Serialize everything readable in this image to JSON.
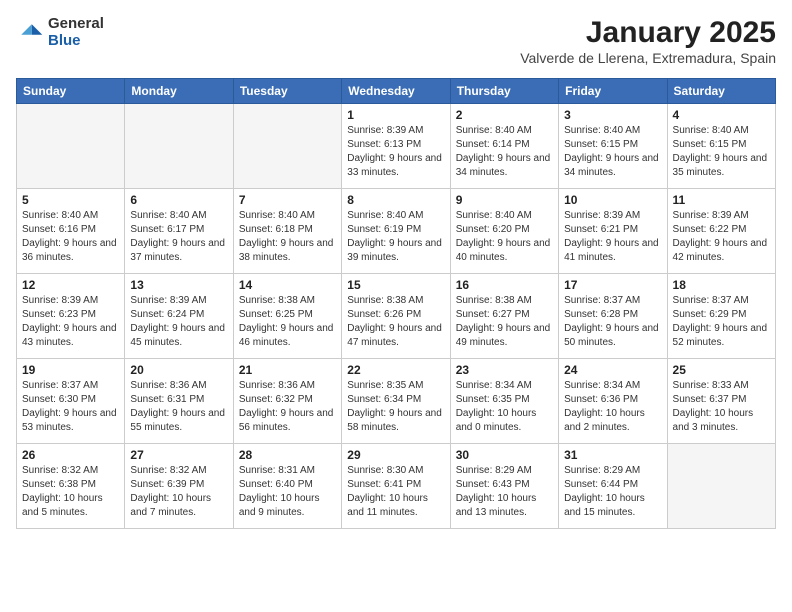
{
  "header": {
    "logo_general": "General",
    "logo_blue": "Blue",
    "month": "January 2025",
    "location": "Valverde de Llerena, Extremadura, Spain"
  },
  "days_of_week": [
    "Sunday",
    "Monday",
    "Tuesday",
    "Wednesday",
    "Thursday",
    "Friday",
    "Saturday"
  ],
  "weeks": [
    [
      {
        "day": "",
        "empty": true
      },
      {
        "day": "",
        "empty": true
      },
      {
        "day": "",
        "empty": true
      },
      {
        "day": "1",
        "sunrise": "8:39 AM",
        "sunset": "6:13 PM",
        "daylight": "9 hours and 33 minutes."
      },
      {
        "day": "2",
        "sunrise": "8:40 AM",
        "sunset": "6:14 PM",
        "daylight": "9 hours and 34 minutes."
      },
      {
        "day": "3",
        "sunrise": "8:40 AM",
        "sunset": "6:15 PM",
        "daylight": "9 hours and 34 minutes."
      },
      {
        "day": "4",
        "sunrise": "8:40 AM",
        "sunset": "6:15 PM",
        "daylight": "9 hours and 35 minutes."
      }
    ],
    [
      {
        "day": "5",
        "sunrise": "8:40 AM",
        "sunset": "6:16 PM",
        "daylight": "9 hours and 36 minutes."
      },
      {
        "day": "6",
        "sunrise": "8:40 AM",
        "sunset": "6:17 PM",
        "daylight": "9 hours and 37 minutes."
      },
      {
        "day": "7",
        "sunrise": "8:40 AM",
        "sunset": "6:18 PM",
        "daylight": "9 hours and 38 minutes."
      },
      {
        "day": "8",
        "sunrise": "8:40 AM",
        "sunset": "6:19 PM",
        "daylight": "9 hours and 39 minutes."
      },
      {
        "day": "9",
        "sunrise": "8:40 AM",
        "sunset": "6:20 PM",
        "daylight": "9 hours and 40 minutes."
      },
      {
        "day": "10",
        "sunrise": "8:39 AM",
        "sunset": "6:21 PM",
        "daylight": "9 hours and 41 minutes."
      },
      {
        "day": "11",
        "sunrise": "8:39 AM",
        "sunset": "6:22 PM",
        "daylight": "9 hours and 42 minutes."
      }
    ],
    [
      {
        "day": "12",
        "sunrise": "8:39 AM",
        "sunset": "6:23 PM",
        "daylight": "9 hours and 43 minutes."
      },
      {
        "day": "13",
        "sunrise": "8:39 AM",
        "sunset": "6:24 PM",
        "daylight": "9 hours and 45 minutes."
      },
      {
        "day": "14",
        "sunrise": "8:38 AM",
        "sunset": "6:25 PM",
        "daylight": "9 hours and 46 minutes."
      },
      {
        "day": "15",
        "sunrise": "8:38 AM",
        "sunset": "6:26 PM",
        "daylight": "9 hours and 47 minutes."
      },
      {
        "day": "16",
        "sunrise": "8:38 AM",
        "sunset": "6:27 PM",
        "daylight": "9 hours and 49 minutes."
      },
      {
        "day": "17",
        "sunrise": "8:37 AM",
        "sunset": "6:28 PM",
        "daylight": "9 hours and 50 minutes."
      },
      {
        "day": "18",
        "sunrise": "8:37 AM",
        "sunset": "6:29 PM",
        "daylight": "9 hours and 52 minutes."
      }
    ],
    [
      {
        "day": "19",
        "sunrise": "8:37 AM",
        "sunset": "6:30 PM",
        "daylight": "9 hours and 53 minutes."
      },
      {
        "day": "20",
        "sunrise": "8:36 AM",
        "sunset": "6:31 PM",
        "daylight": "9 hours and 55 minutes."
      },
      {
        "day": "21",
        "sunrise": "8:36 AM",
        "sunset": "6:32 PM",
        "daylight": "9 hours and 56 minutes."
      },
      {
        "day": "22",
        "sunrise": "8:35 AM",
        "sunset": "6:34 PM",
        "daylight": "9 hours and 58 minutes."
      },
      {
        "day": "23",
        "sunrise": "8:34 AM",
        "sunset": "6:35 PM",
        "daylight": "10 hours and 0 minutes."
      },
      {
        "day": "24",
        "sunrise": "8:34 AM",
        "sunset": "6:36 PM",
        "daylight": "10 hours and 2 minutes."
      },
      {
        "day": "25",
        "sunrise": "8:33 AM",
        "sunset": "6:37 PM",
        "daylight": "10 hours and 3 minutes."
      }
    ],
    [
      {
        "day": "26",
        "sunrise": "8:32 AM",
        "sunset": "6:38 PM",
        "daylight": "10 hours and 5 minutes."
      },
      {
        "day": "27",
        "sunrise": "8:32 AM",
        "sunset": "6:39 PM",
        "daylight": "10 hours and 7 minutes."
      },
      {
        "day": "28",
        "sunrise": "8:31 AM",
        "sunset": "6:40 PM",
        "daylight": "10 hours and 9 minutes."
      },
      {
        "day": "29",
        "sunrise": "8:30 AM",
        "sunset": "6:41 PM",
        "daylight": "10 hours and 11 minutes."
      },
      {
        "day": "30",
        "sunrise": "8:29 AM",
        "sunset": "6:43 PM",
        "daylight": "10 hours and 13 minutes."
      },
      {
        "day": "31",
        "sunrise": "8:29 AM",
        "sunset": "6:44 PM",
        "daylight": "10 hours and 15 minutes."
      },
      {
        "day": "",
        "empty": true
      }
    ]
  ]
}
